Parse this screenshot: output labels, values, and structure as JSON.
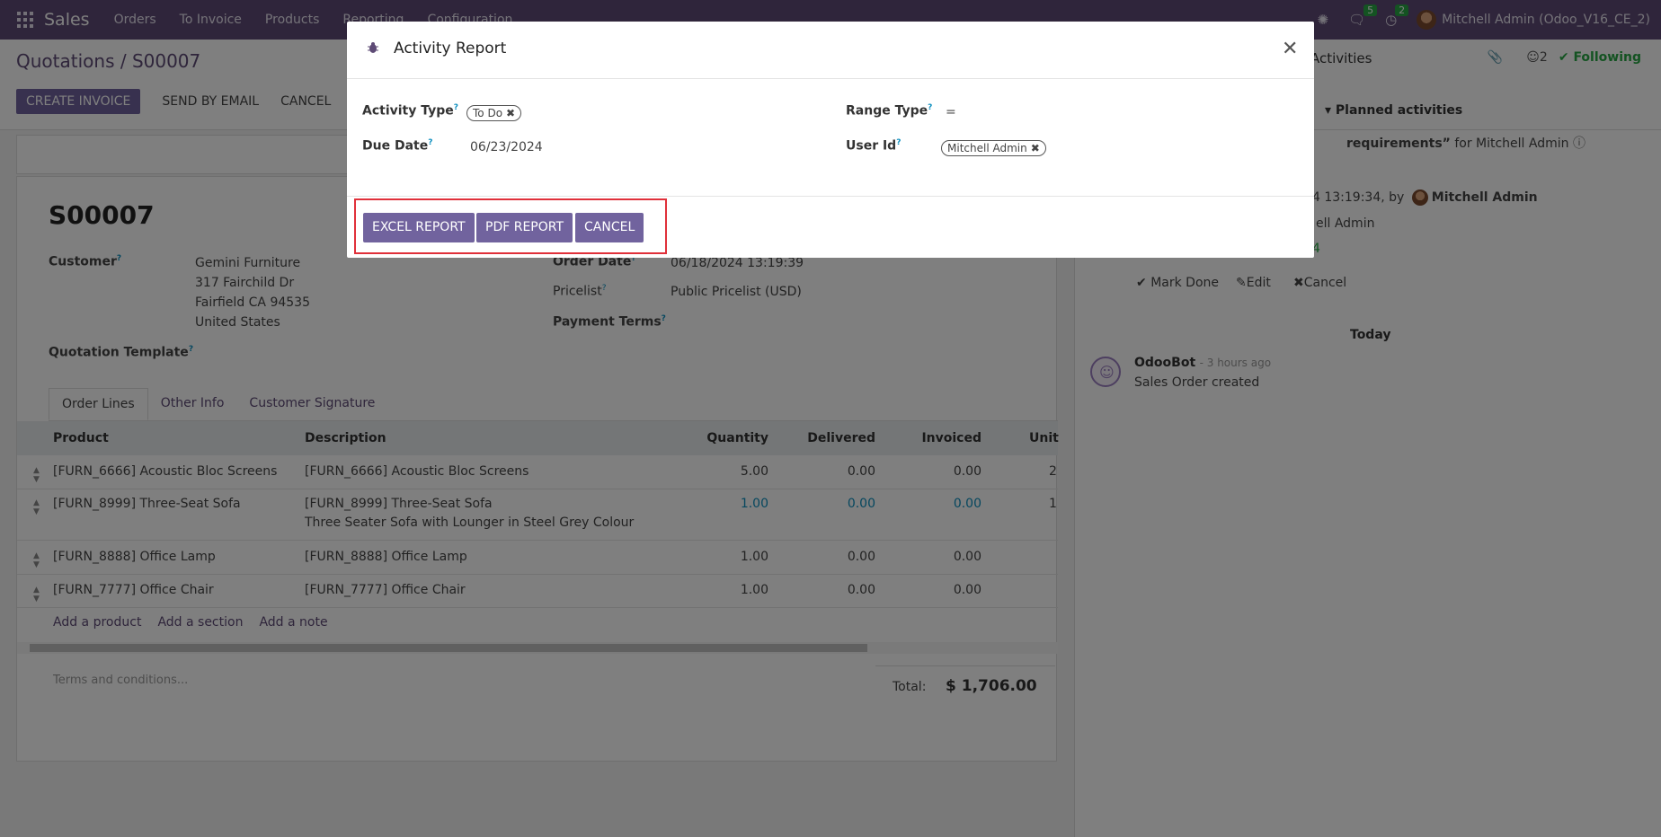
{
  "navbar": {
    "brand": "Sales",
    "menu": [
      "Orders",
      "To Invoice",
      "Products",
      "Reporting",
      "Configuration"
    ],
    "messages_count": "5",
    "activities_count": "2",
    "user": "Mitchell Admin (Odoo_V16_CE_2)"
  },
  "control": {
    "breadcrumb_parent": "Quotations",
    "breadcrumb_sep": " / ",
    "breadcrumb_current": "S00007",
    "create_invoice": "Create Invoice",
    "send_by_email": "Send by Email",
    "cancel": "Cancel",
    "activities": "Activities",
    "followers_count": "2",
    "following": "Following"
  },
  "form": {
    "name": "S00007",
    "customer_label": "Customer",
    "customer_lines": [
      "Gemini Furniture",
      "317 Fairchild Dr",
      "Fairfield CA 94535",
      "United States"
    ],
    "template_label": "Quotation Template",
    "order_date_label": "Order Date",
    "order_date": "06/18/2024 13:19:39",
    "pricelist_label": "Pricelist",
    "pricelist": "Public Pricelist (USD)",
    "payment_terms_label": "Payment Terms",
    "tabs": [
      "Order Lines",
      "Other Info",
      "Customer Signature"
    ],
    "columns": [
      "Product",
      "Description",
      "Quantity",
      "Delivered",
      "Invoiced",
      "Unit"
    ],
    "rows": [
      {
        "product": "[FURN_6666] Acoustic Bloc Screens",
        "desc": "[FURN_6666] Acoustic Bloc Screens",
        "desc2": "",
        "qty": "5.00",
        "delivered": "0.00",
        "invoiced": "0.00",
        "unit": "2"
      },
      {
        "product": "[FURN_8999] Three-Seat Sofa",
        "desc": "[FURN_8999] Three-Seat Sofa",
        "desc2": "Three Seater Sofa with Lounger in Steel Grey Colour",
        "qty": "1.00",
        "delivered": "0.00",
        "invoiced": "0.00",
        "unit": "1"
      },
      {
        "product": "[FURN_8888] Office Lamp",
        "desc": "[FURN_8888] Office Lamp",
        "desc2": "",
        "qty": "1.00",
        "delivered": "0.00",
        "invoiced": "0.00",
        "unit": ""
      },
      {
        "product": "[FURN_7777] Office Chair",
        "desc": "[FURN_7777] Office Chair",
        "desc2": "",
        "qty": "1.00",
        "delivered": "0.00",
        "invoiced": "0.00",
        "unit": ""
      }
    ],
    "add_product": "Add a product",
    "add_section": "Add a section",
    "add_note": "Add a note",
    "terms_placeholder": "Terms and conditions...",
    "total_label": "Total:",
    "total_value": "$ 1,706.00"
  },
  "chatter": {
    "planned_activities": "Planned activities",
    "activity_summary": "requirements”",
    "activity_for": "for Mitchell Admin",
    "activity_date": "4 13:19:34, by",
    "activity_author": "Mitchell Admin",
    "assigned_partial": "ell Admin",
    "due_partial": "4",
    "mark_done": "Mark Done",
    "edit": "Edit",
    "cancel": "Cancel",
    "today": "Today",
    "author": "OdooBot",
    "time": "- 3 hours ago",
    "message": "Sales Order created"
  },
  "modal": {
    "title": "Activity Report",
    "activity_type_label": "Activity Type",
    "activity_type_tag": "To Do",
    "due_date_label": "Due Date",
    "due_date": "06/23/2024",
    "range_type_label": "Range Type",
    "range_type": "=",
    "user_id_label": "User Id",
    "user_tag": "Mitchell Admin",
    "excel_report": "Excel Report",
    "pdf_report": "PDF Report",
    "cancel": "Cancel"
  },
  "colors": {
    "navbar": "#5e4b76",
    "primary_button": "#71639e",
    "highlight": "#e0303a",
    "following": "#28a745"
  }
}
